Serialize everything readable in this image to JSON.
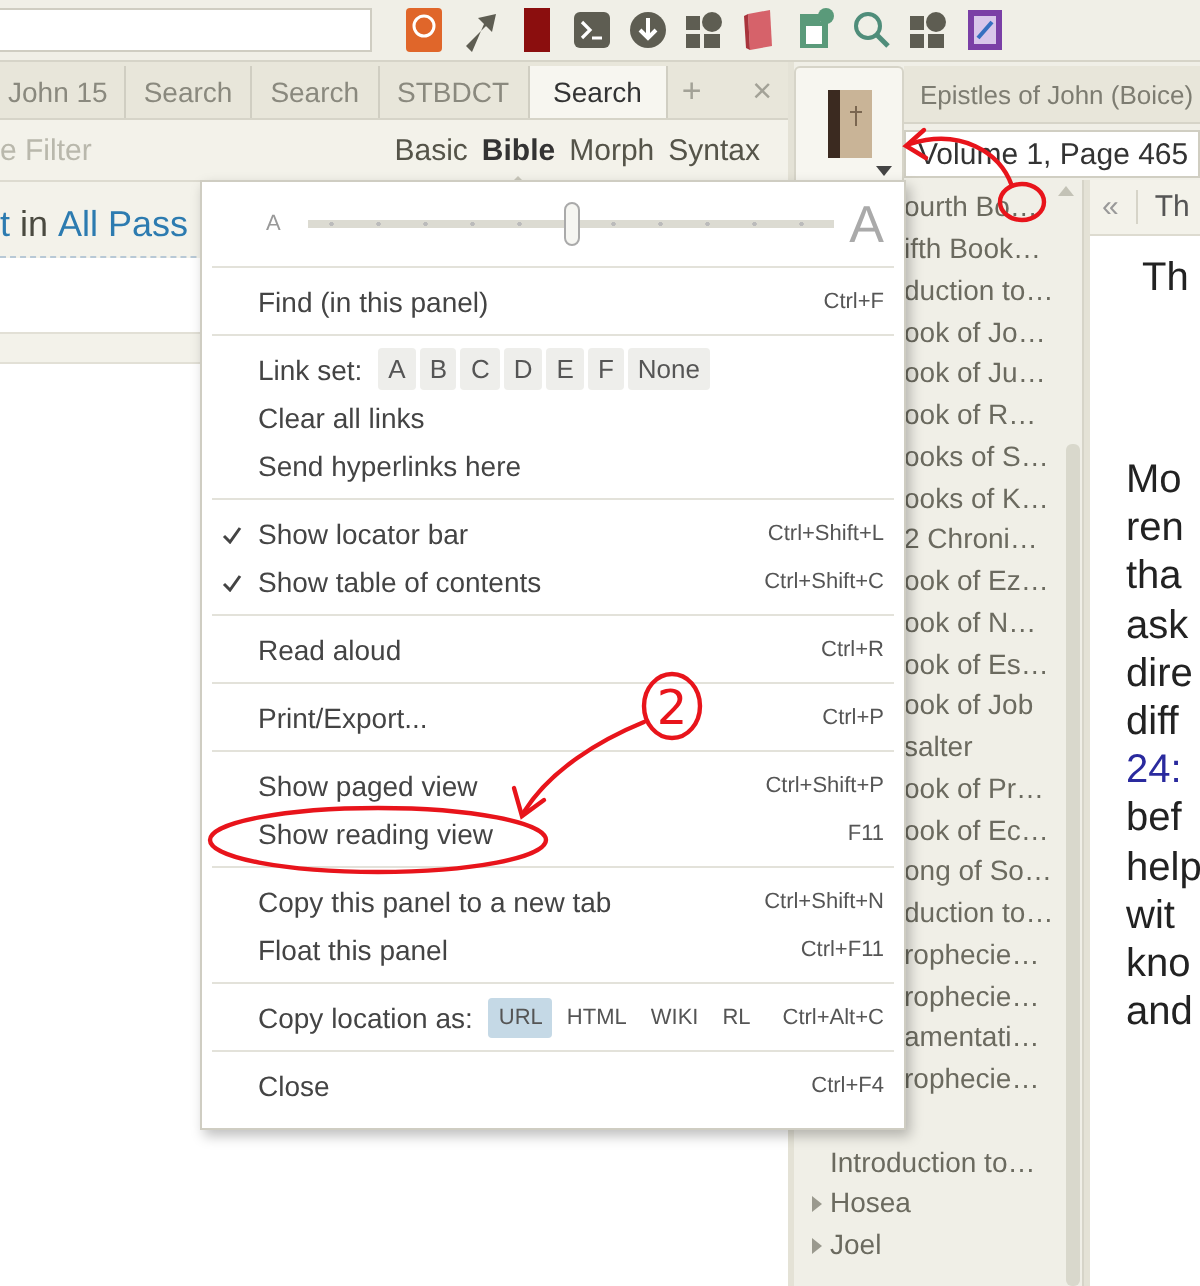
{
  "left_panel": {
    "tabs": [
      {
        "label": "John 15",
        "selected": false
      },
      {
        "label": "Search",
        "selected": false
      },
      {
        "label": "Search",
        "selected": false
      },
      {
        "label": "STBDCT",
        "selected": false
      },
      {
        "label": "Search",
        "selected": true
      }
    ],
    "new_tab": "+",
    "close": "×",
    "filter": {
      "placeholder": "e Filter"
    },
    "search_modes": [
      {
        "label": "Basic",
        "selected": false
      },
      {
        "label": "Bible",
        "selected": true
      },
      {
        "label": "Morph",
        "selected": false
      },
      {
        "label": "Syntax",
        "selected": false
      }
    ],
    "query": [
      {
        "text": "t",
        "kind": "link"
      },
      {
        "text": "in",
        "kind": "plain"
      },
      {
        "text": "All Pass",
        "kind": "link"
      }
    ]
  },
  "right_panel": {
    "tab": "Epistles of John (Boice)",
    "location": "Volume 1, Page 465",
    "toc": [
      {
        "label": "ourth Bo…",
        "kind": "partial",
        "expandable": false
      },
      {
        "label": "ifth Book…",
        "kind": "partial",
        "expandable": false
      },
      {
        "label": "duction to…",
        "kind": "partial",
        "expandable": false
      },
      {
        "label": "ook of Jo…",
        "kind": "partial",
        "expandable": false
      },
      {
        "label": "ook of Ju…",
        "kind": "partial",
        "expandable": false
      },
      {
        "label": "ook of R…",
        "kind": "partial",
        "expandable": false
      },
      {
        "label": "ooks of S…",
        "kind": "partial",
        "expandable": false
      },
      {
        "label": "ooks of K…",
        "kind": "partial",
        "expandable": false
      },
      {
        "label": "2 Chroni…",
        "kind": "partial",
        "expandable": false
      },
      {
        "label": "ook of Ez…",
        "kind": "partial",
        "expandable": false
      },
      {
        "label": "ook of N…",
        "kind": "partial",
        "expandable": false
      },
      {
        "label": "ook of Es…",
        "kind": "partial",
        "expandable": false
      },
      {
        "label": "ook of Job",
        "kind": "partial",
        "expandable": false
      },
      {
        "label": "salter",
        "kind": "partial",
        "expandable": false
      },
      {
        "label": "ook of Pr…",
        "kind": "partial",
        "expandable": false
      },
      {
        "label": "ook of Ec…",
        "kind": "partial",
        "expandable": false
      },
      {
        "label": "ong of So…",
        "kind": "partial",
        "expandable": false
      },
      {
        "label": "duction to…",
        "kind": "partial",
        "expandable": false
      },
      {
        "label": "rophecie…",
        "kind": "partial",
        "expandable": false
      },
      {
        "label": "rophecie…",
        "kind": "partial",
        "expandable": false
      },
      {
        "label": "amentati…",
        "kind": "partial",
        "expandable": false
      },
      {
        "label": "rophecie…",
        "kind": "partial",
        "expandable": false
      },
      {
        "label": "Introduction to…",
        "kind": "entry",
        "expandable": false
      },
      {
        "label": "Hosea",
        "kind": "entry",
        "expandable": true
      },
      {
        "label": "Joel",
        "kind": "entry",
        "expandable": true
      }
    ],
    "back": "«",
    "reading_tab": "Th",
    "heading": "Th",
    "lines": [
      {
        "text": "Mo",
        "kind": "text"
      },
      {
        "text": "ren",
        "kind": "text"
      },
      {
        "text": "tha",
        "kind": "text"
      },
      {
        "text": "ask",
        "kind": "text"
      },
      {
        "text": "dire",
        "kind": "text"
      },
      {
        "text": "diff",
        "kind": "text"
      },
      {
        "text": "24:",
        "kind": "verse"
      },
      {
        "text": "bef",
        "kind": "text"
      },
      {
        "text": "help",
        "kind": "text"
      },
      {
        "text": "wit",
        "kind": "text"
      },
      {
        "text": "kno",
        "kind": "text"
      },
      {
        "text": "and",
        "kind": "text"
      }
    ]
  },
  "menu": {
    "font_size": {
      "small": "A",
      "large": "A",
      "level": 0.5
    },
    "groups": [
      {
        "items": [
          {
            "kind": "item",
            "label": "Find (in this panel)",
            "shortcut": "Ctrl+F",
            "checked": false
          }
        ]
      },
      {
        "items": [
          {
            "kind": "choices",
            "label": "Link set:",
            "options": [
              {
                "label": "A",
                "selected": false
              },
              {
                "label": "B",
                "selected": false
              },
              {
                "label": "C",
                "selected": false
              },
              {
                "label": "D",
                "selected": false
              },
              {
                "label": "E",
                "selected": false
              },
              {
                "label": "F",
                "selected": false
              },
              {
                "label": "None",
                "selected": false
              }
            ]
          },
          {
            "kind": "item",
            "label": "Clear all links",
            "checked": false
          },
          {
            "kind": "item",
            "label": "Send hyperlinks here",
            "checked": false
          }
        ]
      },
      {
        "items": [
          {
            "kind": "item",
            "label": "Show locator bar",
            "shortcut": "Ctrl+Shift+L",
            "checked": true
          },
          {
            "kind": "item",
            "label": "Show table of contents",
            "shortcut": "Ctrl+Shift+C",
            "checked": true
          }
        ]
      },
      {
        "items": [
          {
            "kind": "item",
            "label": "Read aloud",
            "shortcut": "Ctrl+R",
            "checked": false
          }
        ]
      },
      {
        "items": [
          {
            "kind": "item",
            "label": "Print/Export...",
            "shortcut": "Ctrl+P",
            "checked": false
          }
        ]
      },
      {
        "items": [
          {
            "kind": "item",
            "label": "Show paged view",
            "shortcut": "Ctrl+Shift+P",
            "checked": false
          },
          {
            "kind": "item",
            "label": "Show reading view",
            "shortcut": "F11",
            "checked": false
          }
        ]
      },
      {
        "items": [
          {
            "kind": "item",
            "label": "Copy this panel to a new tab",
            "shortcut": "Ctrl+Shift+N",
            "checked": false
          },
          {
            "kind": "item",
            "label": "Float this panel",
            "shortcut": "Ctrl+F11",
            "checked": false
          }
        ]
      },
      {
        "items": [
          {
            "kind": "choices",
            "label": "Copy location as:",
            "shortcut": "Ctrl+Alt+C",
            "options": [
              {
                "label": "URL",
                "selected": true
              },
              {
                "label": "HTML",
                "selected": false
              },
              {
                "label": "WIKI",
                "selected": false
              },
              {
                "label": "RL",
                "selected": false
              }
            ]
          }
        ]
      },
      {
        "items": [
          {
            "kind": "item",
            "label": "Close",
            "shortcut": "Ctrl+F4",
            "checked": false
          }
        ]
      }
    ]
  },
  "annotations": [
    {
      "label": "2"
    }
  ]
}
